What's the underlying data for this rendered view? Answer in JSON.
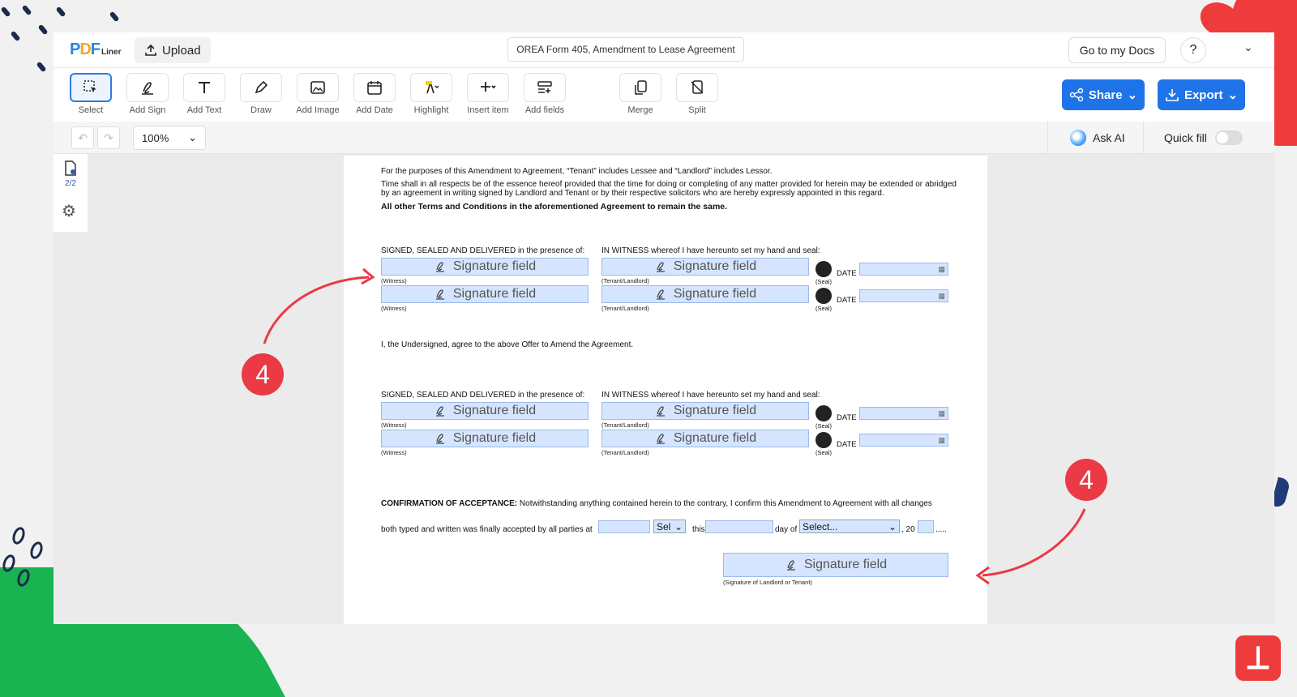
{
  "app": {
    "logo_pdf": "PDF",
    "logo_liner": "Liner",
    "upload_label": "Upload",
    "doc_title": "OREA Form 405, Amendment to Lease Agreement",
    "go_to_docs": "Go to my Docs",
    "help": "?"
  },
  "toolbar": {
    "tools": [
      {
        "label": "Select"
      },
      {
        "label": "Add Sign"
      },
      {
        "label": "Add Text"
      },
      {
        "label": "Draw"
      },
      {
        "label": "Add Image"
      },
      {
        "label": "Add Date"
      },
      {
        "label": "Highlight"
      },
      {
        "label": "Insert item"
      },
      {
        "label": "Add fields"
      },
      {
        "label": "Merge"
      },
      {
        "label": "Split"
      }
    ],
    "share": "Share",
    "export": "Export"
  },
  "subbar": {
    "zoom": "100%",
    "ask_ai": "Ask AI",
    "quick_fill": "Quick fill",
    "quick_fill_on": false
  },
  "leftbar": {
    "pages": "2/2"
  },
  "document": {
    "para1": "For the purposes of this Amendment to Agreement, “Tenant” includes Lessee and “Landlord” includes Lessor.",
    "para2": "Time shall in all respects be of the essence hereof provided that the time for doing or completing of any matter provided for herein may be extended or abridged by an agreement in writing signed by Landlord and Tenant or by their respective solicitors who are hereby expressly appointed in this regard.",
    "para3": "All other Terms and Conditions in the aforementioned Agreement to remain the same.",
    "signed_label": "SIGNED, SEALED AND DELIVERED in the presence of:",
    "witness_label": "IN WITNESS whereof I have hereunto set my hand and seal:",
    "undersigned": "I, the Undersigned, agree to the above Offer to Amend the Agreement.",
    "sig_text": "Signature field",
    "witness_cap": "(Witness)",
    "tenant_cap": "(Tenant/Landlord)",
    "seal_cap": "(Seal)",
    "date_label": "DATE",
    "confirm_bold": "CONFIRMATION OF ACCEPTANCE:",
    "confirm_text": "Notwithstanding anything contained herein to the contrary, I confirm this Amendment to Agreement with all changes",
    "confirm_line2": "both typed and written was finally accepted by all parties at",
    "sel_short": "Sel",
    "this_label": "this",
    "day_of": "day of",
    "select_month": "Select...",
    "year_prefix": ", 20",
    "year_suffix": ".....",
    "final_cap": "(Signature of Landlord or Tenant)"
  },
  "annotations": {
    "step": "4"
  },
  "colors": {
    "accent": "#1e73e8",
    "field_bg": "#d6e5ff",
    "annotation_red": "#ea3a45",
    "deco_green": "#19b352"
  }
}
